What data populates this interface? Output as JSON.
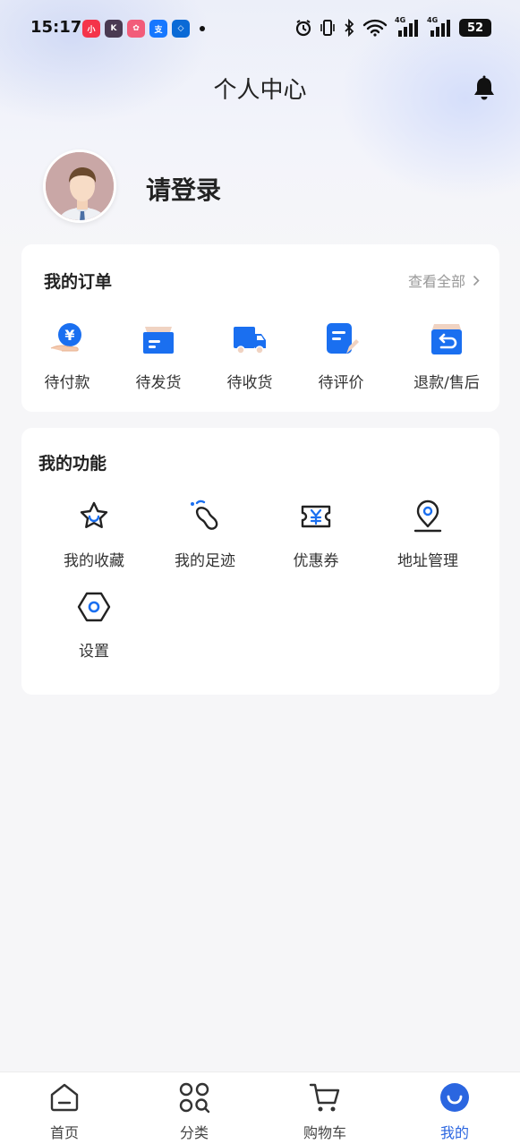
{
  "status_bar": {
    "time": "15:17",
    "notification_apps": [
      "xiaohongshu-icon",
      "k-app-icon",
      "shopping-app-icon",
      "alipay-icon",
      "bank-app-icon"
    ],
    "battery": "52",
    "network_1": "4G",
    "network_2": "4G"
  },
  "header": {
    "title": "个人中心"
  },
  "profile": {
    "login_prompt": "请登录"
  },
  "orders": {
    "title": "我的订单",
    "view_all": "查看全部",
    "items": [
      {
        "label": "待付款",
        "icon": "pay-icon"
      },
      {
        "label": "待发货",
        "icon": "box-icon"
      },
      {
        "label": "待收货",
        "icon": "truck-icon"
      },
      {
        "label": "待评价",
        "icon": "review-icon"
      },
      {
        "label": "退款/售后",
        "icon": "refund-icon"
      }
    ]
  },
  "functions": {
    "title": "我的功能",
    "items": [
      {
        "label": "我的收藏",
        "icon": "star-icon"
      },
      {
        "label": "我的足迹",
        "icon": "footprint-icon"
      },
      {
        "label": "优惠券",
        "icon": "coupon-icon"
      },
      {
        "label": "地址管理",
        "icon": "location-icon"
      },
      {
        "label": "设置",
        "icon": "settings-icon"
      }
    ]
  },
  "tabbar": {
    "items": [
      {
        "label": "首页",
        "icon": "home-icon"
      },
      {
        "label": "分类",
        "icon": "category-icon"
      },
      {
        "label": "购物车",
        "icon": "cart-icon"
      },
      {
        "label": "我的",
        "icon": "profile-icon"
      }
    ],
    "active_index": 3
  },
  "colors": {
    "accent": "#2b66e0",
    "background": "#f6f6f8",
    "text": "#222222"
  }
}
